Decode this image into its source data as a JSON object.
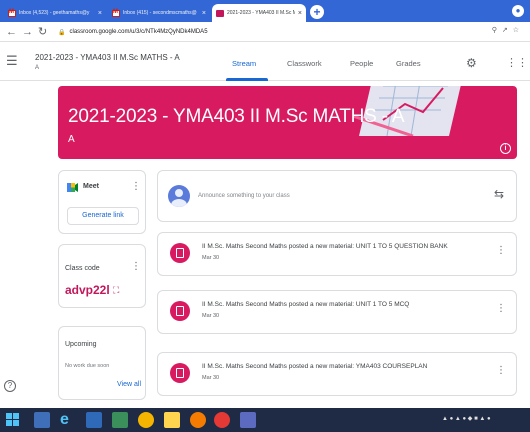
{
  "browser": {
    "tabs": [
      {
        "label": "Inbox (4,523) - geethamaths@y",
        "active": false,
        "icon": "gmail-icon"
      },
      {
        "label": "Inbox (415) - secondmscmaths@",
        "active": false,
        "icon": "gmail-icon"
      },
      {
        "label": "2021-2023 - YMA403 II M.Sc M",
        "active": true,
        "icon": "classroom-icon"
      }
    ],
    "url": "classroom.google.com/u/3/c/NTk4MzQyNDk4MDA5"
  },
  "header": {
    "class_title": "2021-2023 - YMA403 II M.Sc MATHS - A",
    "class_section": "A",
    "tabs": [
      "Stream",
      "Classwork",
      "People",
      "Grades"
    ],
    "active_tab": "Stream"
  },
  "banner": {
    "title": "2021-2023 - YMA403 II M.Sc MATHS - A",
    "section": "A",
    "color": "#d81b60"
  },
  "meet": {
    "label": "Meet",
    "button": "Generate link"
  },
  "class_code": {
    "label": "Class code",
    "value": "advp22l"
  },
  "upcoming": {
    "label": "Upcoming",
    "empty_text": "No work due soon",
    "view_all": "View all"
  },
  "announce": {
    "placeholder": "Announce something to your class"
  },
  "posts": [
    {
      "title": "II M.Sc. Maths Second Maths posted a new material: UNIT 1 TO 5 QUESTION BANK",
      "date": "Mar 30"
    },
    {
      "title": "II M.Sc. Maths Second Maths posted a new material: UNIT 1 TO 5 MCQ",
      "date": "Mar 30"
    },
    {
      "title": "II M.Sc. Maths Second Maths posted a new material: YMA403 COURSEPLAN",
      "date": "Mar 30"
    }
  ],
  "accent_color": "#1967d2",
  "brand_color": "#c2185b"
}
